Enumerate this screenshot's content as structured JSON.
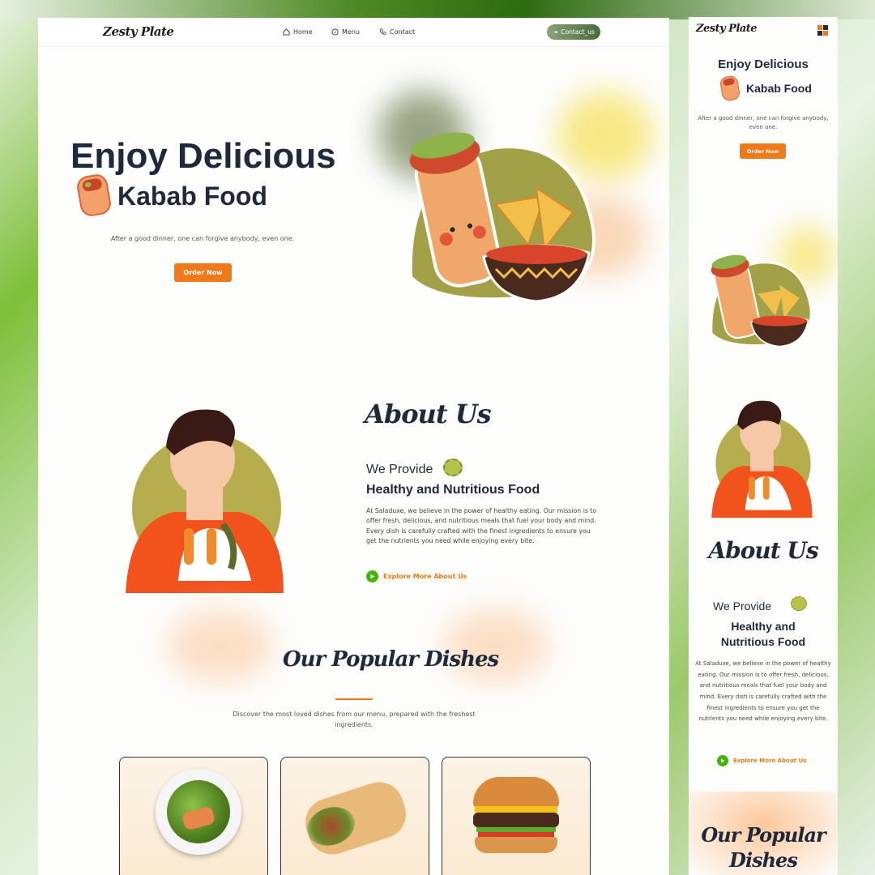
{
  "brand": {
    "logo": "Zesty Plate"
  },
  "nav": {
    "home": "Home",
    "menu": "Menu",
    "contact": "Contact",
    "contact_button": "Contact_us"
  },
  "hero": {
    "title_line1": "Enjoy Delicious",
    "title_line2": "Kabab Food",
    "subtitle": "After a good dinner, one can forgive anybody, even one.",
    "cta": "Order Now"
  },
  "about": {
    "heading": "About Us",
    "line1": "We Provide",
    "line2": "Healthy and Nutritious Food",
    "body": "At Saladuxe, we believe in the power of healthy eating. Our mission is to offer fresh, delicious, and nutritious meals that fuel your body and mind. Every dish is carefully crafted with the finest ingredients to ensure you get the nutrients you need while enjoying every bite.",
    "link": "Explore More About Us"
  },
  "popular": {
    "heading": "Our Popular Dishes",
    "description": "Discover the most loved dishes from our menu, prepared with the freshest ingredients.",
    "dishes": [
      {
        "icon": "salad-plate-image"
      },
      {
        "icon": "wrap-image"
      },
      {
        "icon": "burger-image"
      }
    ]
  },
  "mobile": {
    "title_line1": "Enjoy Delicious",
    "title_line2": "Kabab Food",
    "about_line1": "We Provide",
    "about_line2a": "Healthy and",
    "about_line2b": "Nutritious Food",
    "popular_line1": "Our Popular",
    "popular_line2": "Dishes"
  },
  "colors": {
    "accent": "#f07a1a",
    "dark": "#1e2a3b",
    "play": "#45b40a",
    "olive": "#a9a548"
  }
}
